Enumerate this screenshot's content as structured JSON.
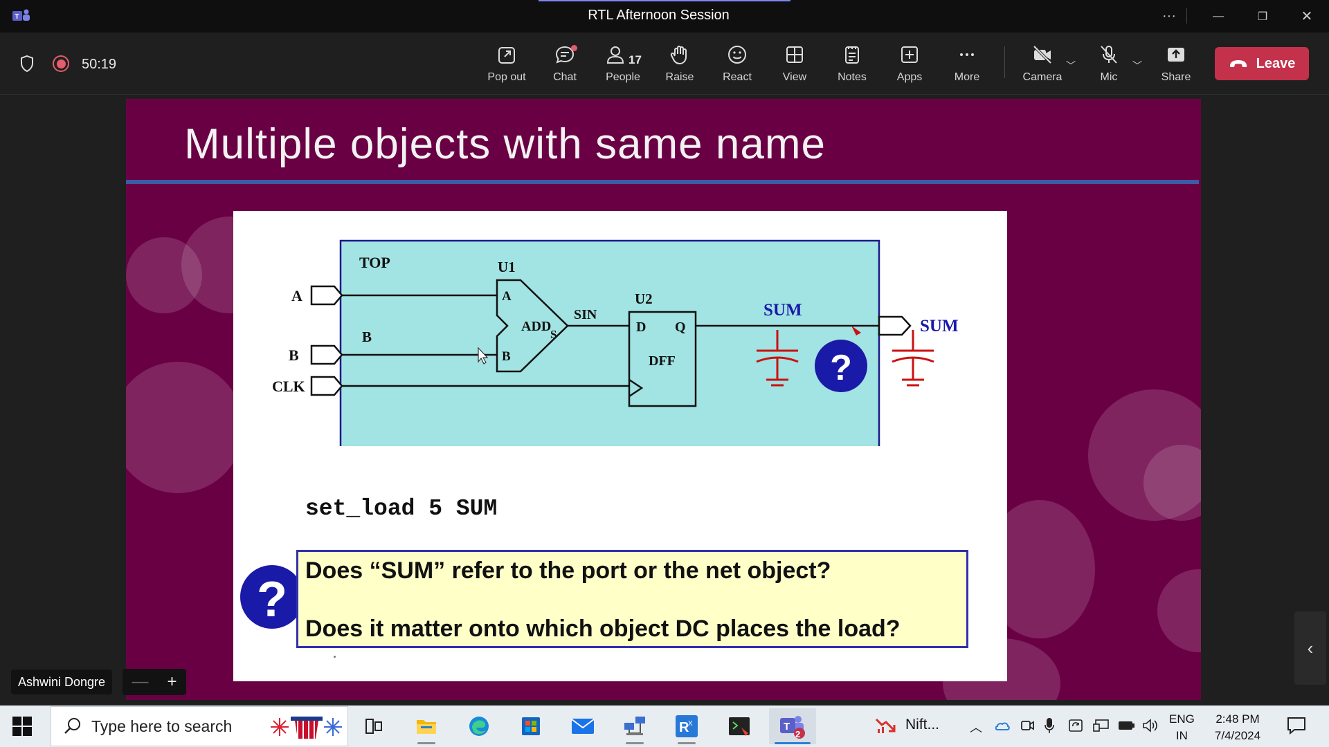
{
  "window": {
    "title": "RTL Afternoon Session",
    "controls": {
      "more": "···",
      "minimize": "—",
      "restore": "❐",
      "close": "✕"
    }
  },
  "toolbar": {
    "timer": "50:19",
    "buttons": [
      {
        "label": "Pop out",
        "icon": "popout-icon"
      },
      {
        "label": "Chat",
        "icon": "chat-icon"
      },
      {
        "label": "People",
        "icon": "people-icon",
        "count": "17"
      },
      {
        "label": "Raise",
        "icon": "hand-icon"
      },
      {
        "label": "React",
        "icon": "smiley-icon"
      },
      {
        "label": "View",
        "icon": "grid-icon"
      },
      {
        "label": "Notes",
        "icon": "notes-icon"
      },
      {
        "label": "Apps",
        "icon": "plus-icon"
      },
      {
        "label": "More",
        "icon": "ellipsis-icon"
      },
      {
        "label": "Camera",
        "icon": "camera-off-icon"
      },
      {
        "label": "Mic",
        "icon": "mic-off-icon"
      },
      {
        "label": "Share",
        "icon": "share-icon"
      }
    ],
    "leave_label": "Leave"
  },
  "slide": {
    "title": "Multiple objects with same name",
    "circuit": {
      "top_label": "TOP",
      "inputs": [
        "A",
        "B",
        "CLK"
      ],
      "net_b": "B",
      "u1": "U1",
      "u1_pin_a": "A",
      "u1_pin_b": "B",
      "u1_name": "ADD",
      "u1_out": "S",
      "net_sin": "SIN",
      "u2": "U2",
      "u2_d": "D",
      "u2_q": "Q",
      "u2_name": "DFF",
      "net_sum": "SUM",
      "port_sum": "SUM",
      "question": "?"
    },
    "command": "set_load 5 SUM",
    "question_1": "Does “SUM” refer to the port or the net object?",
    "question_2": "Does it matter onto which object DC places the load?",
    "question_icon": "?"
  },
  "participant": {
    "name": "Ashwini Dongre",
    "zoom_out": "—",
    "zoom_in": "+"
  },
  "side_arrow": "‹",
  "taskbar": {
    "search_placeholder": "Type here to search",
    "apps": [
      "task-view",
      "file-explorer",
      "edge",
      "store",
      "mail",
      "network-app",
      "rdp-app",
      "terminal",
      "teams"
    ],
    "teams_badge": "2",
    "widget_label": "Nift...",
    "language_1": "ENG",
    "language_2": "IN",
    "time": "2:48 PM",
    "date": "7/4/2024"
  },
  "colors": {
    "slide_bg": "#6a0044",
    "leave": "#c4314b",
    "cyan": "#a2e3e3",
    "question_blue": "#1a1aa8",
    "cap_red": "#cc1111"
  }
}
